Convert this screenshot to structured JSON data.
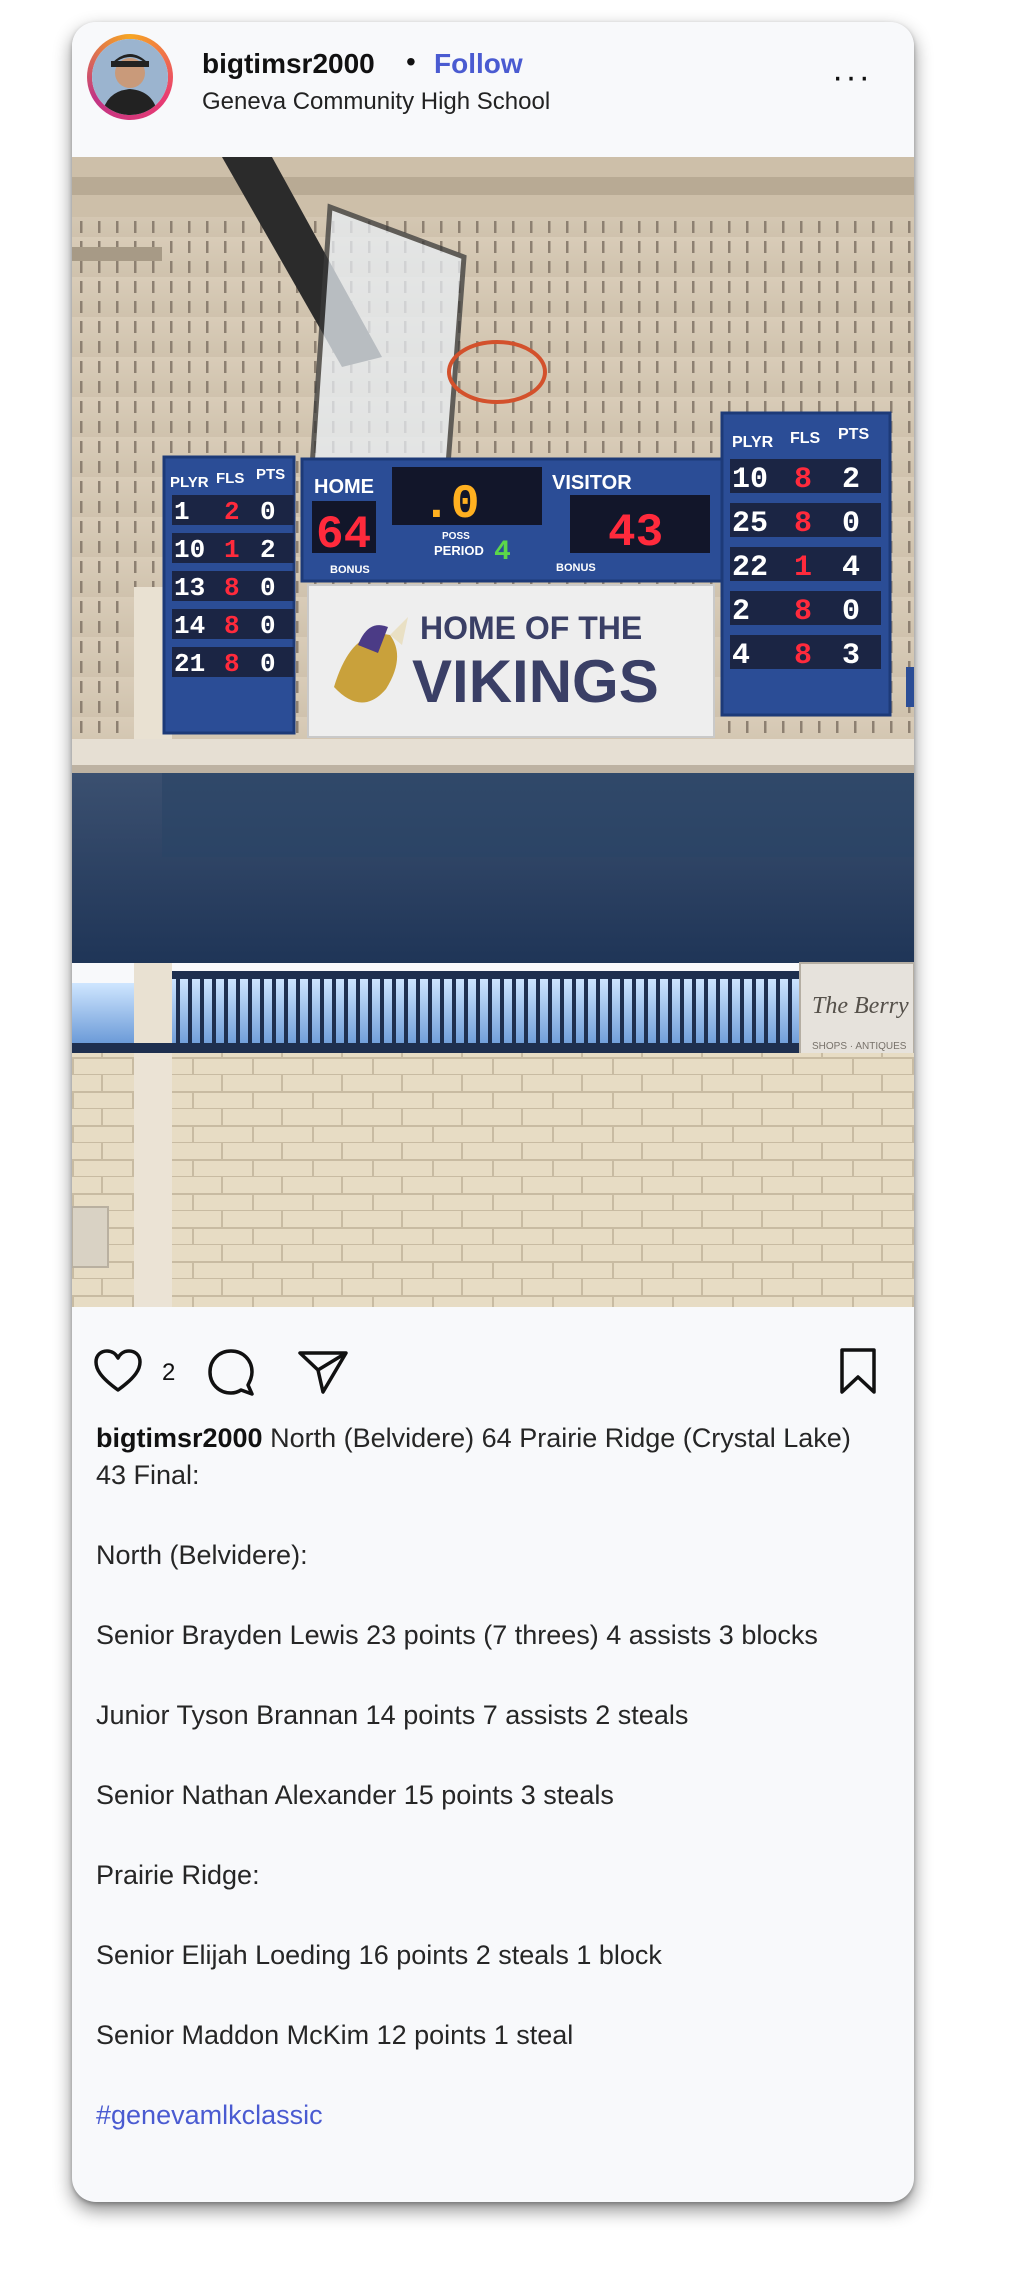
{
  "post": {
    "username": "bigtimsr2000",
    "separator": "•",
    "follow_label": "Follow",
    "location": "Geneva Community High School",
    "more_label": "···",
    "likes": "2"
  },
  "scoreboard": {
    "home_label": "HOME",
    "home_score": "64",
    "visitor_label": "VISITOR",
    "visitor_score": "43",
    "clock": ".0",
    "period_label": "PERIOD",
    "period": "4",
    "poss_label": "POSS",
    "bonus_label": "BONUS",
    "plyr_label": "PLYR",
    "fls_label": "FLS",
    "pts_label": "PTS",
    "home_players": [
      {
        "no": "1",
        "fls": "2",
        "pts": "0"
      },
      {
        "no": "10",
        "fls": "1",
        "pts": "2"
      },
      {
        "no": "13",
        "fls": "8",
        "pts": "0"
      },
      {
        "no": "14",
        "fls": "8",
        "pts": "0"
      },
      {
        "no": "21",
        "fls": "8",
        "pts": "0"
      }
    ],
    "visitor_players": [
      {
        "no": "10",
        "fls": "8",
        "pts": "2"
      },
      {
        "no": "25",
        "fls": "8",
        "pts": "0"
      },
      {
        "no": "22",
        "fls": "1",
        "pts": "4"
      },
      {
        "no": "2",
        "fls": "8",
        "pts": "0"
      },
      {
        "no": "4",
        "fls": "8",
        "pts": "3"
      }
    ],
    "banner_line1": "HOME OF THE",
    "banner_line2": "VIKINGS",
    "sign_text": "The Berry",
    "sign_sub": "SHOPS · ANTIQUES"
  },
  "caption": {
    "lead": "North (Belvidere) 64 Prairie Ridge (Crystal Lake) 43 Final:",
    "lines": [
      "North (Belvidere):",
      "Senior Brayden Lewis 23 points (7 threes) 4 assists 3 blocks",
      "Junior Tyson Brannan 14 points 7 assists 2 steals",
      "Senior Nathan Alexander 15 points 3 steals",
      "Prairie Ridge:",
      "Senior Elijah Loeding 16 points 2 steals 1 block",
      "Senior Maddon McKim 12 points 1 steal"
    ],
    "hashtag": "#genevamlkclassic"
  },
  "colors": {
    "link": "#4a5bd1",
    "led_red": "#ff2a3c",
    "led_green": "#5bd64a",
    "board_blue": "#2b4d96"
  }
}
